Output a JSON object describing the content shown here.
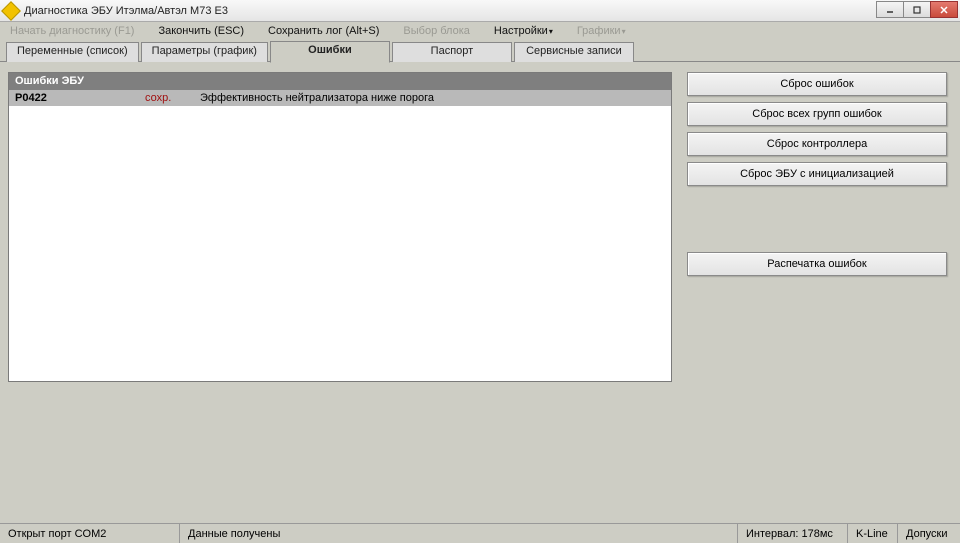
{
  "window": {
    "title": "Диагностика ЭБУ Итэлма/Автэл М73 Е3"
  },
  "menu": {
    "start": "Начать диагностику (F1)",
    "finish": "Закончить (ESC)",
    "savelog": "Сохранить лог (Alt+S)",
    "selectblock": "Выбор блока",
    "settings": "Настройки",
    "graphs": "Графики"
  },
  "tabs": {
    "vars": "Переменные (список)",
    "params": "Параметры (график)",
    "errors": "Ошибки",
    "passport": "Паспорт",
    "service": "Сервисные записи"
  },
  "panel": {
    "header": "Ошибки ЭБУ"
  },
  "errors": [
    {
      "code": "P0422",
      "status": "сохр.",
      "desc": "Эффективность нейтрализатора ниже порога"
    }
  ],
  "buttons": {
    "reset_errors": "Сброс ошибок",
    "reset_all_groups": "Сброс всех групп ошибок",
    "reset_controller": "Сброс контроллера",
    "reset_ecu_init": "Сброс ЭБУ с инициализацией",
    "print_errors": "Распечатка ошибок"
  },
  "status": {
    "port": "Открыт порт COM2",
    "data": "Данные получены",
    "interval": "Интервал: 178мс",
    "proto": "K-Line",
    "tolerances": "Допуски"
  }
}
